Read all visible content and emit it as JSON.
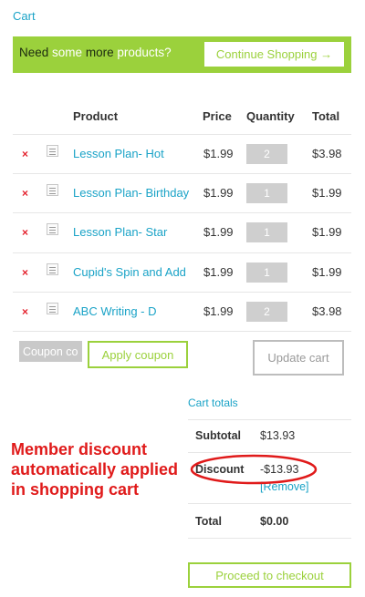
{
  "page": {
    "title": "Cart"
  },
  "banner": {
    "text_part1": "Need",
    "text_part2": "some",
    "text_part3": "more",
    "text_part4": "products?",
    "continue_label": "Continue Shopping →",
    "color": "#9bd13c"
  },
  "table": {
    "headers": {
      "product": "Product",
      "price": "Price",
      "quantity": "Quantity",
      "total": "Total"
    },
    "remove_symbol": "×",
    "rows": [
      {
        "product": "Lesson Plan- Hot",
        "price": "$1.99",
        "quantity": "2",
        "total": "$3.98"
      },
      {
        "product": "Lesson Plan- Birthday",
        "price": "$1.99",
        "quantity": "1",
        "total": "$1.99"
      },
      {
        "product": "Lesson Plan- Star",
        "price": "$1.99",
        "quantity": "1",
        "total": "$1.99"
      },
      {
        "product": "Cupid's Spin and Add",
        "price": "$1.99",
        "quantity": "1",
        "total": "$1.99"
      },
      {
        "product": "ABC Writing - D",
        "price": "$1.99",
        "quantity": "2",
        "total": "$3.98"
      }
    ]
  },
  "coupon": {
    "placeholder": "Coupon code",
    "apply_label": "Apply coupon"
  },
  "update_label": "Update cart",
  "totals": {
    "title": "Cart totals",
    "subtotal_label": "Subtotal",
    "subtotal_value": "$13.93",
    "discount_label": "Discount",
    "discount_value": "-$13.93",
    "remove_label": "[Remove]",
    "total_label": "Total",
    "total_value": "$0.00"
  },
  "annotation": {
    "line1": "Member discount",
    "line2": "automatically applied",
    "line3": "in shopping cart",
    "color": "#e01a1a"
  },
  "checkout_label": "Proceed to checkout",
  "colors": {
    "accent_blue": "#1aa3c7",
    "accent_green": "#9bd13c",
    "remove_red": "#e4232f"
  }
}
